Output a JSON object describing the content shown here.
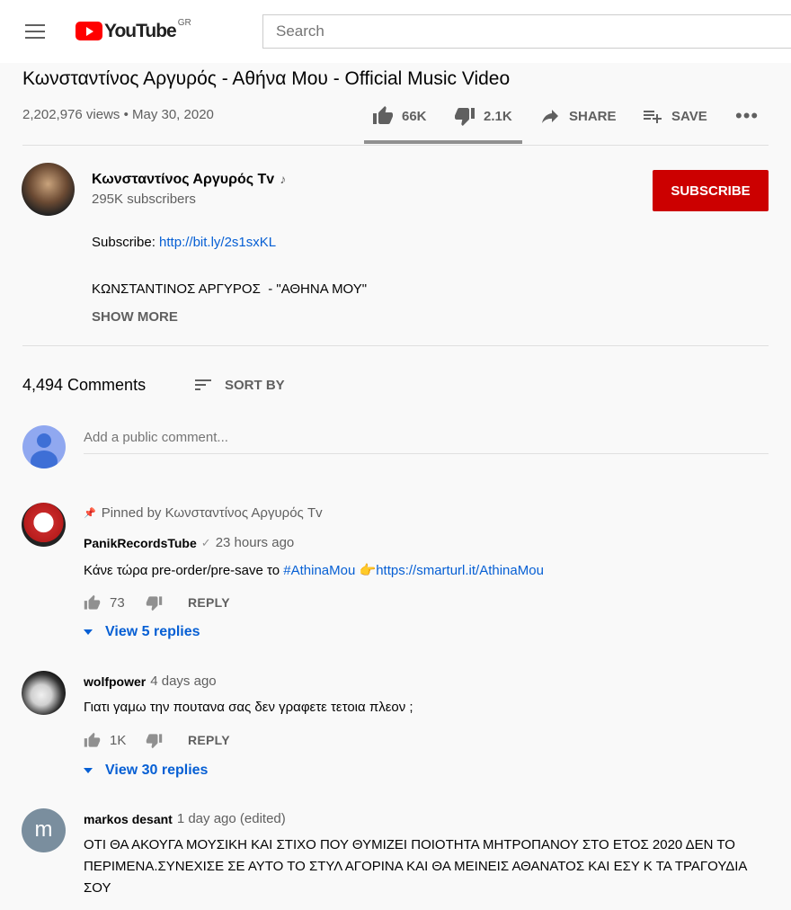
{
  "header": {
    "logo_text": "YouTube",
    "region": "GR",
    "search_placeholder": "Search"
  },
  "video": {
    "title": "Κωνσταντίνος Αργυρός - Αθήνα Μου - Official Music Video",
    "meta": "2,202,976 views • May 30, 2020",
    "likes": "66K",
    "dislikes": "2.1K",
    "share_label": "SHARE",
    "save_label": "SAVE",
    "like_ratio": 0.97
  },
  "channel": {
    "name": "Κωνσταντίνος Αργυρός Tv",
    "subscribers": "295K subscribers",
    "subscribe_label": "SUBSCRIBE"
  },
  "description": {
    "subscribe_prefix": "Subscribe: ",
    "subscribe_link": "http://bit.ly/2s1sxKL",
    "line2": "ΚΩΝΣΤΑΝΤΙΝΟΣ ΑΡΓΥΡΟΣ  - \"ΑΘΗΝΑ ΜΟΥ\"",
    "show_more": "SHOW MORE"
  },
  "comments": {
    "count": "4,494 Comments",
    "sort_label": "SORT BY",
    "add_placeholder": "Add a public comment...",
    "items": [
      {
        "pinned_text": "Pinned by Κωνσταντίνος Αργυρός Tv",
        "author": "PanikRecordsTube",
        "time": "23 hours ago",
        "text_prefix": "Κάνε τώρα pre-order/pre-save το ",
        "hashtag": "#AthinaMou",
        "emoji": "👉",
        "url": "https://smarturl.it/AthinaMou",
        "likes": "73",
        "reply_label": "REPLY",
        "view_replies": "View 5 replies"
      },
      {
        "author": "wolfpower",
        "time": "4 days ago",
        "text": "Γιατι γαμω την πουτανα σας δεν γραφετε τετοια πλεον ;",
        "likes": "1K",
        "reply_label": "REPLY",
        "view_replies": "View 30 replies"
      },
      {
        "author": "markos desant",
        "time": "1 day ago (edited)",
        "avatar_letter": "m",
        "text": "ΟΤΙ ΘΑ ΑΚΟΥΓΑ ΜΟΥΣΙΚΗ ΚΑΙ ΣΤΙΧΟ  ΠΟΥ ΘΥΜΙΖΕΙ ΠΟΙΟΤΗΤΑ ΜΗΤΡΟΠΑΝΟΥ ΣΤΟ ΕΤΟΣ 2020 ΔΕΝ ΤΟ ΠΕΡΙΜΕΝΑ.ΣΥΝΕΧΙΣΕ ΣΕ ΑΥΤΟ ΤΟ ΣΤΥΛ ΑΓΟΡΙΝΑ ΚΑΙ ΘΑ ΜΕΙΝΕΙΣ ΑΘΑΝΑΤΟΣ ΚΑΙ ΕΣΥ Κ ΤΑ ΤΡΑΓΟΥΔΙΑ ΣΟΥ"
      }
    ]
  },
  "colors": {
    "brand_red": "#ff0000",
    "subscribe_red": "#cc0000",
    "link_blue": "#065fd4"
  }
}
